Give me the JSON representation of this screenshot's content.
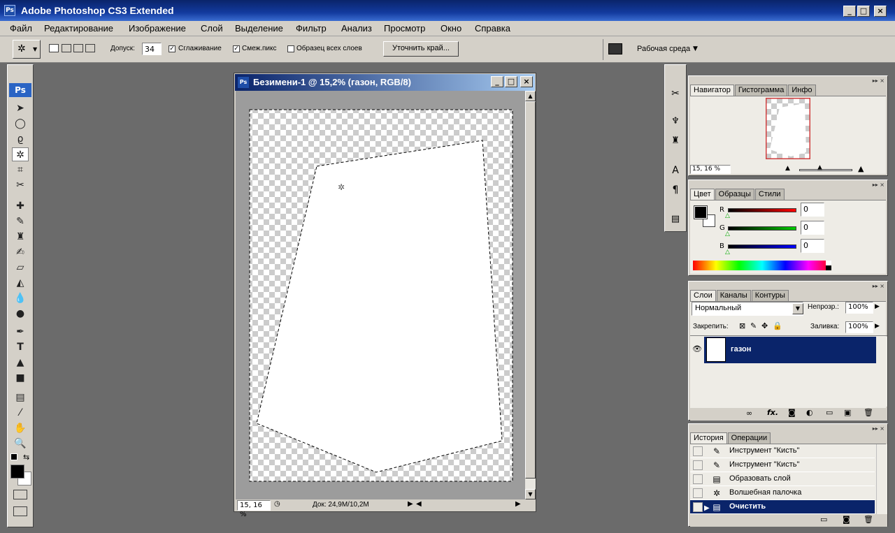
{
  "app": {
    "title": "Adobe Photoshop CS3 Extended",
    "ps_logo": "Ps"
  },
  "window_controls": [
    "_",
    "□",
    "×"
  ],
  "menu": [
    "Файл",
    "Редактирование",
    "Изображение",
    "Слой",
    "Выделение",
    "Фильтр",
    "Анализ",
    "Просмотр",
    "Окно",
    "Справка"
  ],
  "options": {
    "tolerance_label": "Допуск:",
    "tolerance_value": "34",
    "antialias_label": "Сглаживание",
    "antialias_checked": true,
    "contiguous_label": "Смеж.пикс",
    "contiguous_checked": true,
    "sample_all_label": "Образец всех слоев",
    "sample_all_checked": false,
    "refine_edge_label": "Уточнить край...",
    "workspace_label": "Рабочая среда"
  },
  "toolbox": {
    "logo": "Ps"
  },
  "document": {
    "title": "Безимени-1 @ 15,2% (газон, RGB/8)",
    "zoom": "15, 16 %",
    "doc_info": "Док: 24,9M/10,2M"
  },
  "navigator": {
    "tabs": [
      "Навигатор",
      "Гистограмма",
      "Инфо"
    ],
    "zoom": "15, 16 %"
  },
  "color": {
    "tabs": [
      "Цвет",
      "Образцы",
      "Стили"
    ],
    "channels": [
      {
        "label": "R",
        "value": "0",
        "color": "#ff0000"
      },
      {
        "label": "G",
        "value": "0",
        "color": "#00cc00"
      },
      {
        "label": "B",
        "value": "0",
        "color": "#0000ff"
      }
    ]
  },
  "layers": {
    "tabs": [
      "Слои",
      "Каналы",
      "Контуры"
    ],
    "blend_mode": "Нормальный",
    "opacity_label": "Непрозр.:",
    "opacity_value": "100%",
    "lock_label": "Закрепить:",
    "fill_label": "Заливка:",
    "fill_value": "100%",
    "layer_name": "газон"
  },
  "history": {
    "tabs": [
      "История",
      "Операции"
    ],
    "items": [
      {
        "label": "Инструмент \"Кисть\"",
        "icon": "brush-icon",
        "selected": false
      },
      {
        "label": "Инструмент \"Кисть\"",
        "icon": "brush-icon",
        "selected": false
      },
      {
        "label": "Образовать слой",
        "icon": "layer-icon",
        "selected": false
      },
      {
        "label": "Волшебная палочка",
        "icon": "magic-wand-icon",
        "selected": false
      },
      {
        "label": "Очистить",
        "icon": "clear-icon",
        "selected": true
      }
    ]
  },
  "colors": {
    "selection": "#0a246a",
    "panel_bg": "#d4d0c8",
    "workspace": "#6b6b6b"
  }
}
